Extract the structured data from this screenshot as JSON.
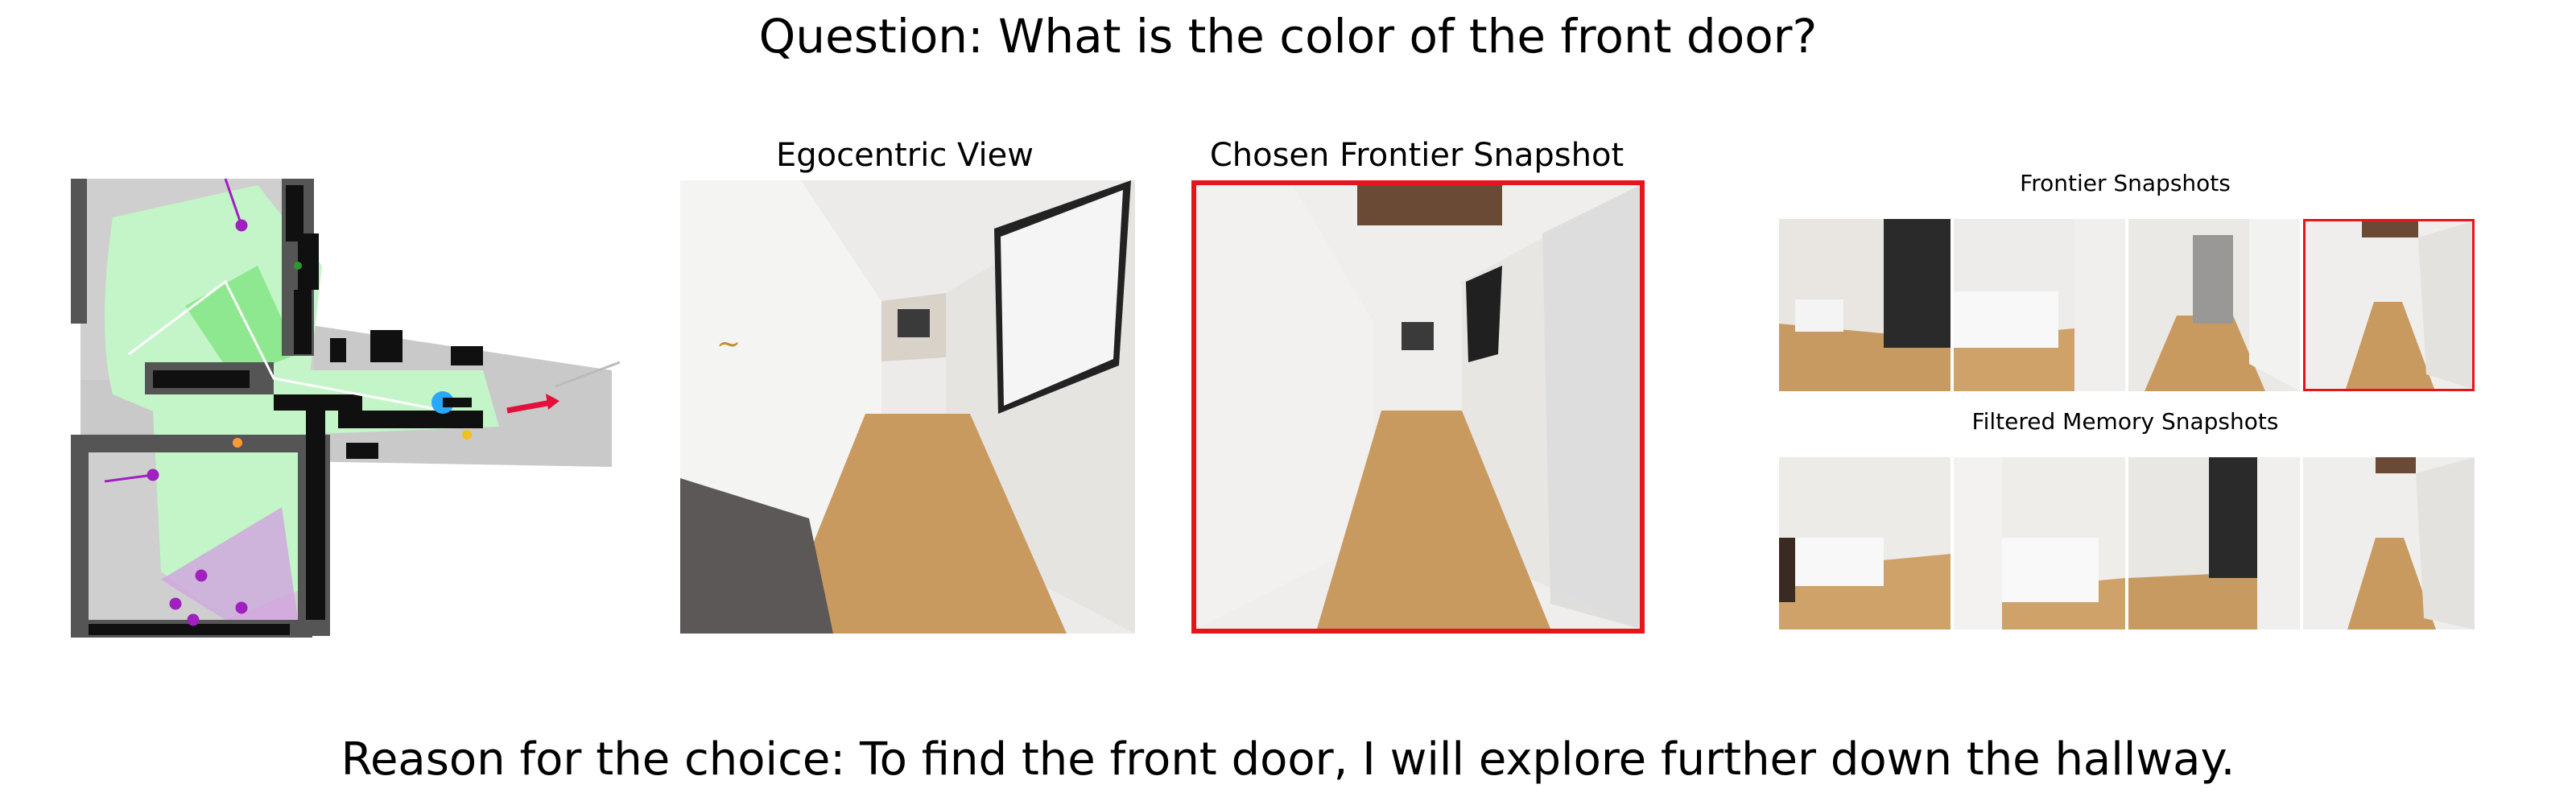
{
  "question": "Question: What is the color of the front door?",
  "reason": "Reason for the choice: To find the front door, I will explore further down the hallway.",
  "panels": {
    "egocentric_title": "Egocentric View",
    "chosen_title": "Chosen Frontier Snapshot",
    "frontier_title": "Frontier Snapshots",
    "memory_title": "Filtered Memory Snapshots"
  },
  "colors": {
    "chosen_highlight": "#e8141c",
    "explored_area": "#c3f5c8",
    "obstacle": "#101010",
    "agent": "#2aa7ff",
    "frontier_arrow": "#e2103c",
    "object_marker": "#a020c0"
  },
  "frontier_snapshots": [
    {
      "scene": "living-room-chalkboard",
      "selected": false
    },
    {
      "scene": "bedroom",
      "selected": false
    },
    {
      "scene": "hallway-mirror",
      "selected": false
    },
    {
      "scene": "hallway-long",
      "selected": true
    }
  ],
  "memory_snapshots": [
    {
      "scene": "bedroom-wide"
    },
    {
      "scene": "bedroom-close"
    },
    {
      "scene": "corridor-chalkboard"
    },
    {
      "scene": "hallway-end"
    }
  ]
}
